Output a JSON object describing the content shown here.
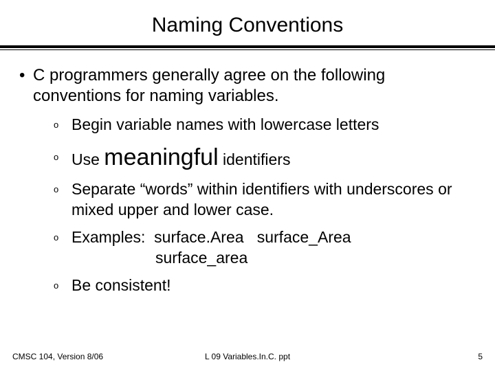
{
  "title": "Naming Conventions",
  "main_bullet": "C programmers generally agree on the following conventions for naming variables.",
  "sub": [
    "Begin variable names with lowercase letters",
    {
      "pre": "Use ",
      "big": "meaningful",
      "post": " identifiers"
    },
    "Separate “words” within identifiers with underscores or mixed upper and lower case.",
    {
      "line1": "Examples:  surface.Area   surface_Area",
      "line2": "surface_area"
    },
    "Be consistent!"
  ],
  "footer": {
    "left": "CMSC 104, Version 8/06",
    "center": "L 09 Variables.In.C. ppt",
    "right": "5"
  }
}
